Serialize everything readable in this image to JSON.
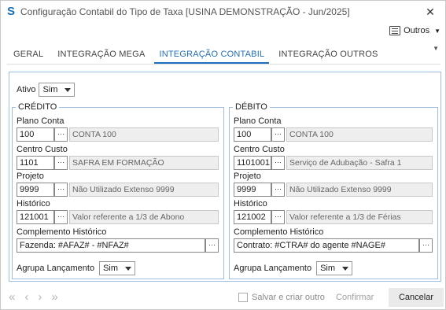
{
  "window": {
    "title": "Configuração Contabil do Tipo de Taxa [USINA DEMONSTRAÇÃO - Jun/2025]",
    "close_glyph": "✕",
    "app_glyph": "S"
  },
  "toolbar": {
    "outros_label": "Outros"
  },
  "tabs": [
    {
      "label": "GERAL",
      "active": false
    },
    {
      "label": "INTEGRAÇÃO MEGA",
      "active": false
    },
    {
      "label": "INTEGRAÇÃO CONTABIL",
      "active": true
    },
    {
      "label": "INTEGRAÇÃO OUTROS",
      "active": false
    }
  ],
  "ativo": {
    "label": "Ativo",
    "value": "Sim"
  },
  "credito": {
    "legend": "CRÉDITO",
    "plano_conta": {
      "label": "Plano Conta",
      "code": "100",
      "desc": "CONTA 100"
    },
    "centro_custo": {
      "label": "Centro Custo",
      "code": "1101",
      "desc": "SAFRA EM FORMAÇÃO"
    },
    "projeto": {
      "label": "Projeto",
      "code": "9999",
      "desc": "Não Utilizado Extenso 9999"
    },
    "historico": {
      "label": "Histórico",
      "code": "121001",
      "desc": "Valor referente a 1/3 de Abono"
    },
    "complemento": {
      "label": "Complemento Histórico",
      "value": "Fazenda: #AFAZ# - #NFAZ#"
    },
    "agrupa": {
      "label": "Agrupa Lançamento",
      "value": "Sim"
    }
  },
  "debito": {
    "legend": "DÉBITO",
    "plano_conta": {
      "label": "Plano Conta",
      "code": "100",
      "desc": "CONTA 100"
    },
    "centro_custo": {
      "label": "Centro Custo",
      "code": "1101001",
      "desc": "Serviço de Adubação - Safra 1"
    },
    "projeto": {
      "label": "Projeto",
      "code": "9999",
      "desc": "Não Utilizado Extenso 9999"
    },
    "historico": {
      "label": "Histórico",
      "code": "121002",
      "desc": "Valor referente a 1/3 de Férias"
    },
    "complemento": {
      "label": "Complemento Histórico",
      "value": "Contrato: #CTRA# do agente #NAGE#"
    },
    "agrupa": {
      "label": "Agrupa Lançamento",
      "value": "Sim"
    }
  },
  "lookup_button": "···",
  "footer": {
    "nav_first": "«",
    "nav_prev": "‹",
    "nav_next": "›",
    "nav_last": "»",
    "salvar_label": "Salvar e criar outro",
    "confirmar_label": "Confirmar",
    "cancelar_label": "Cancelar"
  }
}
